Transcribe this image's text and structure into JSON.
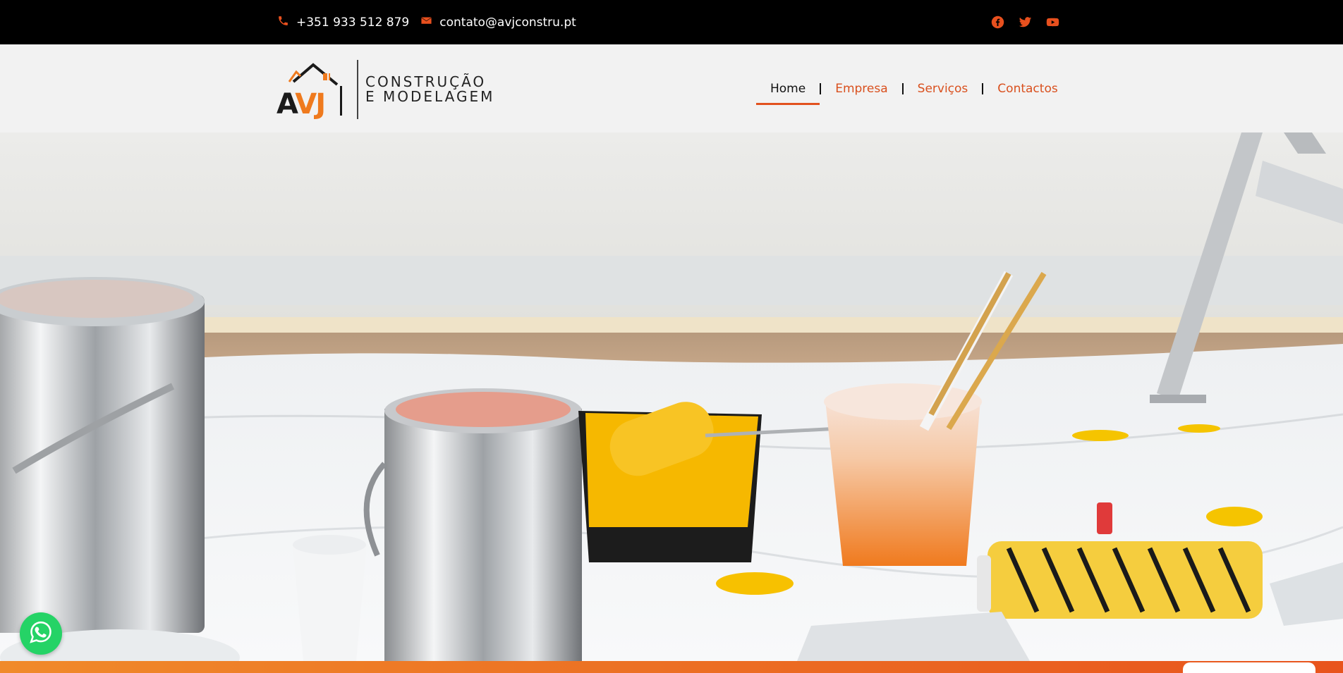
{
  "topbar": {
    "phone": "+351 933 512 879",
    "email": "contato@avjconstru.pt",
    "social": [
      "facebook-icon",
      "twitter-icon",
      "youtube-icon"
    ],
    "icon_color": "#e8501e"
  },
  "logo": {
    "letters_a": "A",
    "letters_vj": "VJ",
    "line1": "CONSTRUÇÃO",
    "line2": "E MODELAGEM"
  },
  "nav": {
    "items": [
      {
        "label": "Home",
        "active": true
      },
      {
        "label": "Empresa",
        "active": false
      },
      {
        "label": "Serviços",
        "active": false
      },
      {
        "label": "Contactos",
        "active": false
      }
    ],
    "accent": "#e2521f"
  },
  "hero": {
    "image": "painting-supplies-photo"
  },
  "floating": {
    "whatsapp": "whatsapp-icon"
  }
}
